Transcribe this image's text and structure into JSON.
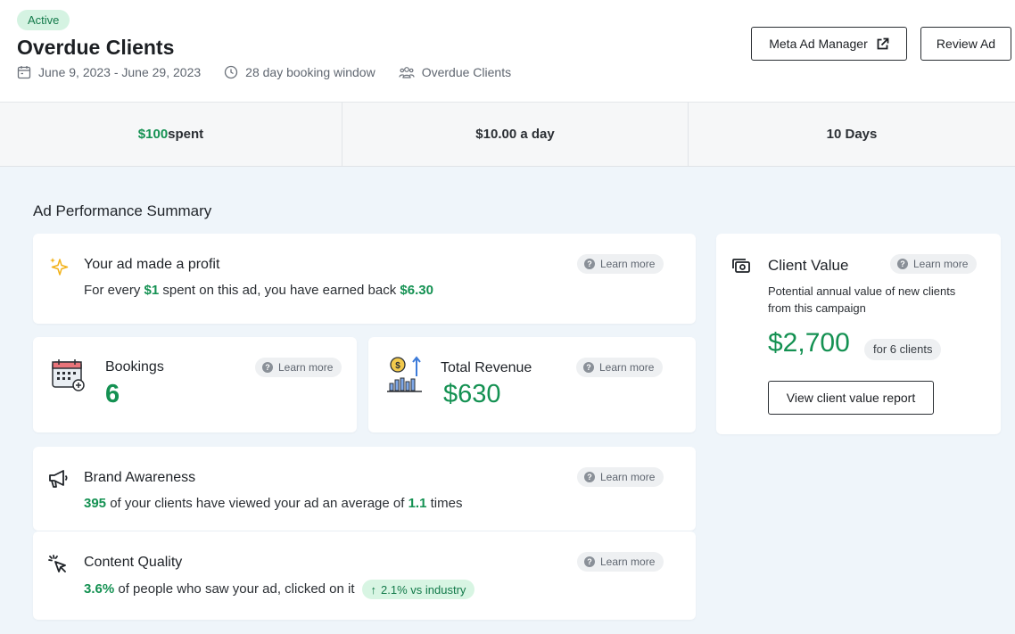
{
  "header": {
    "status_badge": "Active",
    "title": "Overdue Clients",
    "date_range": "June 9, 2023 - June 29, 2023",
    "booking_window": "28 day booking window",
    "audience": "Overdue Clients",
    "meta_button": "Meta Ad Manager",
    "review_button": "Review Ad"
  },
  "stats": {
    "spent_amount": "$100",
    "spent_label": " spent",
    "daily": "$10.00 a day",
    "duration": "10 Days"
  },
  "summary": {
    "section_title": "Ad Performance Summary",
    "learn_more": "Learn more",
    "profit": {
      "title": "Your ad made a profit",
      "text_prefix": "For every ",
      "spent_unit": "$1",
      "text_middle": " spent on this ad, you have earned back ",
      "earned": "$6.30"
    },
    "bookings": {
      "title": "Bookings",
      "value": "6"
    },
    "revenue": {
      "title": "Total Revenue",
      "value": "$630"
    },
    "brand": {
      "title": "Brand Awareness",
      "viewers": "395",
      "text_middle": " of your clients have viewed your ad an average of ",
      "average": "1.1",
      "text_suffix": " times"
    },
    "content": {
      "title": "Content Quality",
      "ctr": "3.6%",
      "text_middle": " of people who saw your ad, clicked on it",
      "comparison": "2.1% vs industry"
    }
  },
  "client_value": {
    "title": "Client Value",
    "description": "Potential annual value of new clients from this campaign",
    "value": "$2,700",
    "clients_pill": "for 6 clients",
    "report_button": "View client value report"
  },
  "colors": {
    "accent_green": "#149152",
    "badge_bg": "#d5f3e2",
    "main_bg": "#eff5fa"
  },
  "icons": [
    "calendar-icon",
    "clock-icon",
    "users-icon",
    "external-link-icon",
    "sparkle-icon",
    "booking-calendar-icon",
    "revenue-chart-icon",
    "megaphone-icon",
    "cursor-click-icon",
    "money-icon",
    "help-icon",
    "arrow-up-icon"
  ]
}
